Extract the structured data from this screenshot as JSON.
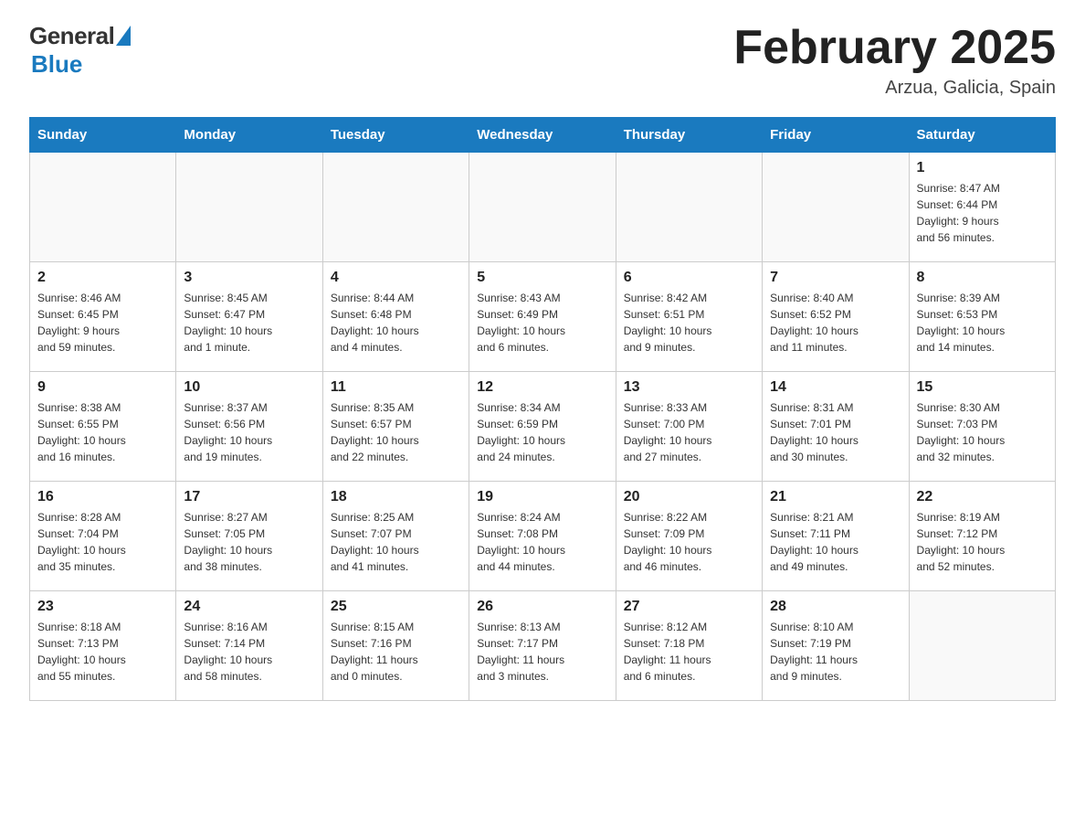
{
  "header": {
    "logo_general": "General",
    "logo_blue": "Blue",
    "title": "February 2025",
    "location": "Arzua, Galicia, Spain"
  },
  "days_of_week": [
    "Sunday",
    "Monday",
    "Tuesday",
    "Wednesday",
    "Thursday",
    "Friday",
    "Saturday"
  ],
  "weeks": [
    [
      {
        "day": "",
        "info": ""
      },
      {
        "day": "",
        "info": ""
      },
      {
        "day": "",
        "info": ""
      },
      {
        "day": "",
        "info": ""
      },
      {
        "day": "",
        "info": ""
      },
      {
        "day": "",
        "info": ""
      },
      {
        "day": "1",
        "info": "Sunrise: 8:47 AM\nSunset: 6:44 PM\nDaylight: 9 hours\nand 56 minutes."
      }
    ],
    [
      {
        "day": "2",
        "info": "Sunrise: 8:46 AM\nSunset: 6:45 PM\nDaylight: 9 hours\nand 59 minutes."
      },
      {
        "day": "3",
        "info": "Sunrise: 8:45 AM\nSunset: 6:47 PM\nDaylight: 10 hours\nand 1 minute."
      },
      {
        "day": "4",
        "info": "Sunrise: 8:44 AM\nSunset: 6:48 PM\nDaylight: 10 hours\nand 4 minutes."
      },
      {
        "day": "5",
        "info": "Sunrise: 8:43 AM\nSunset: 6:49 PM\nDaylight: 10 hours\nand 6 minutes."
      },
      {
        "day": "6",
        "info": "Sunrise: 8:42 AM\nSunset: 6:51 PM\nDaylight: 10 hours\nand 9 minutes."
      },
      {
        "day": "7",
        "info": "Sunrise: 8:40 AM\nSunset: 6:52 PM\nDaylight: 10 hours\nand 11 minutes."
      },
      {
        "day": "8",
        "info": "Sunrise: 8:39 AM\nSunset: 6:53 PM\nDaylight: 10 hours\nand 14 minutes."
      }
    ],
    [
      {
        "day": "9",
        "info": "Sunrise: 8:38 AM\nSunset: 6:55 PM\nDaylight: 10 hours\nand 16 minutes."
      },
      {
        "day": "10",
        "info": "Sunrise: 8:37 AM\nSunset: 6:56 PM\nDaylight: 10 hours\nand 19 minutes."
      },
      {
        "day": "11",
        "info": "Sunrise: 8:35 AM\nSunset: 6:57 PM\nDaylight: 10 hours\nand 22 minutes."
      },
      {
        "day": "12",
        "info": "Sunrise: 8:34 AM\nSunset: 6:59 PM\nDaylight: 10 hours\nand 24 minutes."
      },
      {
        "day": "13",
        "info": "Sunrise: 8:33 AM\nSunset: 7:00 PM\nDaylight: 10 hours\nand 27 minutes."
      },
      {
        "day": "14",
        "info": "Sunrise: 8:31 AM\nSunset: 7:01 PM\nDaylight: 10 hours\nand 30 minutes."
      },
      {
        "day": "15",
        "info": "Sunrise: 8:30 AM\nSunset: 7:03 PM\nDaylight: 10 hours\nand 32 minutes."
      }
    ],
    [
      {
        "day": "16",
        "info": "Sunrise: 8:28 AM\nSunset: 7:04 PM\nDaylight: 10 hours\nand 35 minutes."
      },
      {
        "day": "17",
        "info": "Sunrise: 8:27 AM\nSunset: 7:05 PM\nDaylight: 10 hours\nand 38 minutes."
      },
      {
        "day": "18",
        "info": "Sunrise: 8:25 AM\nSunset: 7:07 PM\nDaylight: 10 hours\nand 41 minutes."
      },
      {
        "day": "19",
        "info": "Sunrise: 8:24 AM\nSunset: 7:08 PM\nDaylight: 10 hours\nand 44 minutes."
      },
      {
        "day": "20",
        "info": "Sunrise: 8:22 AM\nSunset: 7:09 PM\nDaylight: 10 hours\nand 46 minutes."
      },
      {
        "day": "21",
        "info": "Sunrise: 8:21 AM\nSunset: 7:11 PM\nDaylight: 10 hours\nand 49 minutes."
      },
      {
        "day": "22",
        "info": "Sunrise: 8:19 AM\nSunset: 7:12 PM\nDaylight: 10 hours\nand 52 minutes."
      }
    ],
    [
      {
        "day": "23",
        "info": "Sunrise: 8:18 AM\nSunset: 7:13 PM\nDaylight: 10 hours\nand 55 minutes."
      },
      {
        "day": "24",
        "info": "Sunrise: 8:16 AM\nSunset: 7:14 PM\nDaylight: 10 hours\nand 58 minutes."
      },
      {
        "day": "25",
        "info": "Sunrise: 8:15 AM\nSunset: 7:16 PM\nDaylight: 11 hours\nand 0 minutes."
      },
      {
        "day": "26",
        "info": "Sunrise: 8:13 AM\nSunset: 7:17 PM\nDaylight: 11 hours\nand 3 minutes."
      },
      {
        "day": "27",
        "info": "Sunrise: 8:12 AM\nSunset: 7:18 PM\nDaylight: 11 hours\nand 6 minutes."
      },
      {
        "day": "28",
        "info": "Sunrise: 8:10 AM\nSunset: 7:19 PM\nDaylight: 11 hours\nand 9 minutes."
      },
      {
        "day": "",
        "info": ""
      }
    ]
  ]
}
